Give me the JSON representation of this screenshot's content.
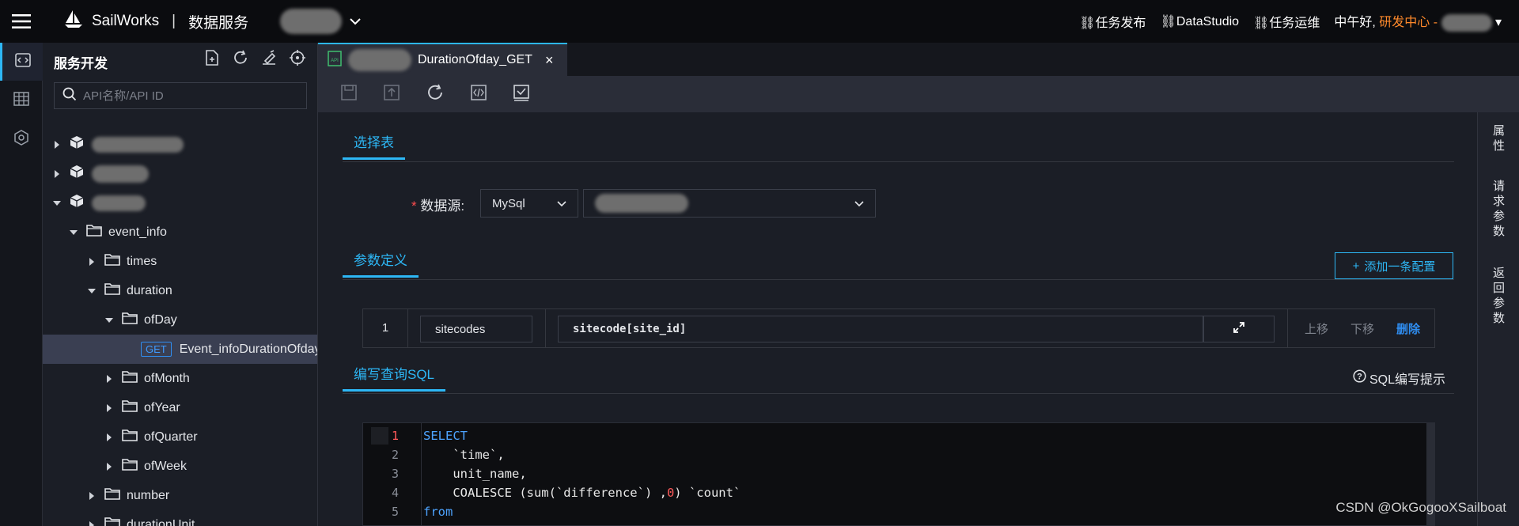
{
  "header": {
    "brand": "SailWorks",
    "section": "数据服务",
    "links": [
      "任务发布",
      "DataStudio",
      "任务运维"
    ],
    "greeting": "中午好,",
    "org": "研发中心 -"
  },
  "tree": {
    "title": "服务开发",
    "search_placeholder": "API名称/API ID",
    "nodes": [
      {
        "label": "event_info"
      },
      {
        "label": "times"
      },
      {
        "label": "duration"
      },
      {
        "label": "ofDay"
      },
      {
        "label": "Event_infoDurationOfday",
        "method": "GET"
      },
      {
        "label": "ofMonth"
      },
      {
        "label": "ofYear"
      },
      {
        "label": "ofQuarter"
      },
      {
        "label": "ofWeek"
      },
      {
        "label": "number"
      },
      {
        "label": "durationUnit"
      }
    ]
  },
  "tab": {
    "title": "DurationOfday_GET",
    "close": "×",
    "api_badge": "API"
  },
  "right_panel": [
    "属\n性",
    "请\n求\n参\n数",
    "返\n回\n参\n数"
  ],
  "select_table": {
    "tab_label": "选择表",
    "datasource_required": "*",
    "datasource_label": "数据源:",
    "datasource_type": "MySql"
  },
  "params": {
    "tab_label": "参数定义",
    "add_button": "添加一条配置",
    "rows": [
      {
        "index": "1",
        "name": "sitecodes",
        "expr": "sitecode[site_id]",
        "move_up": "上移",
        "move_down": "下移",
        "delete": "删除"
      }
    ]
  },
  "sql": {
    "tab_label": "编写查询SQL",
    "hint": "SQL编写提示",
    "lines": [
      {
        "n": "1",
        "text": "SELECT"
      },
      {
        "n": "2",
        "text": "    `time`,"
      },
      {
        "n": "3",
        "text": "    unit_name,"
      },
      {
        "n": "4",
        "pre": "    COALESCE (sum(`difference`) ,",
        "num": "0",
        "post": ") `count`"
      },
      {
        "n": "5",
        "text": "from"
      }
    ]
  },
  "watermark": "CSDN @OkGogooXSailboat",
  "colors": {
    "accent": "#2db7f5",
    "orange": "#ff8a2b",
    "keyword": "#4da3ff",
    "error": "#ff5a5a"
  }
}
